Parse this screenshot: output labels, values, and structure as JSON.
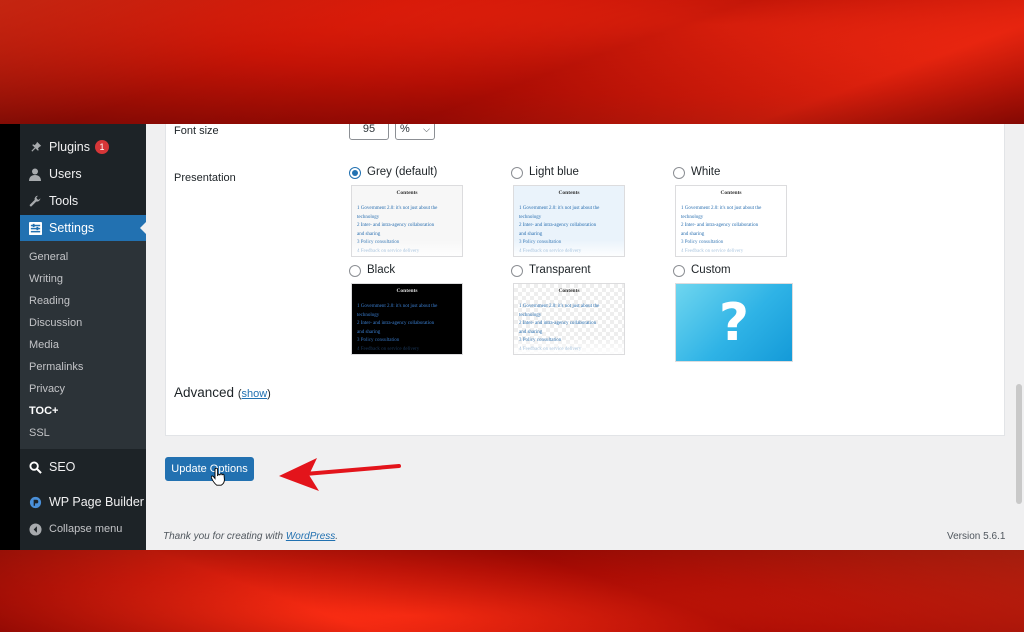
{
  "sidebar": {
    "main_items": [
      {
        "id": "plugins",
        "label": "Plugins",
        "icon": "plugin-icon",
        "badge": "1"
      },
      {
        "id": "users",
        "label": "Users",
        "icon": "user-icon"
      },
      {
        "id": "tools",
        "label": "Tools",
        "icon": "wrench-icon"
      },
      {
        "id": "settings",
        "label": "Settings",
        "icon": "settings-icon",
        "active": true
      }
    ],
    "submenu": [
      "General",
      "Writing",
      "Reading",
      "Discussion",
      "Media",
      "Permalinks",
      "Privacy",
      "TOC+",
      "SSL"
    ],
    "submenu_current": "TOC+",
    "seo_label": "SEO",
    "page_builder_label": "WP Page Builder",
    "collapse_label": "Collapse menu"
  },
  "settings": {
    "font_size_label": "Font size",
    "font_size_value": "95",
    "font_size_unit": "%",
    "presentation_label": "Presentation",
    "presentation_options": [
      {
        "id": "grey",
        "label": "Grey (default)",
        "checked": true
      },
      {
        "id": "lightblue",
        "label": "Light blue",
        "checked": false
      },
      {
        "id": "white",
        "label": "White",
        "checked": false
      },
      {
        "id": "black",
        "label": "Black",
        "checked": false
      },
      {
        "id": "transparent",
        "label": "Transparent",
        "checked": false
      },
      {
        "id": "custom",
        "label": "Custom",
        "checked": false
      }
    ],
    "thumb_title": "Contents",
    "thumb_lines": [
      "1 Government 2.0: it's not just about the",
      "technology",
      "2 Inter- and intra-agency collaboration",
      "and sharing",
      "3 Policy consultation",
      "4 Feedback on service delivery"
    ],
    "advanced_label": "Advanced",
    "advanced_link": "show"
  },
  "actions": {
    "update_button": "Update Options"
  },
  "footer": {
    "thanks_prefix": "Thank you for creating with",
    "thanks_link": "WordPress",
    "thanks_suffix": ".",
    "version": "Version 5.6.1"
  },
  "colors": {
    "sidebar_bg": "#1d2327",
    "accent": "#2271b1",
    "annotation_arrow": "#e3141b"
  }
}
